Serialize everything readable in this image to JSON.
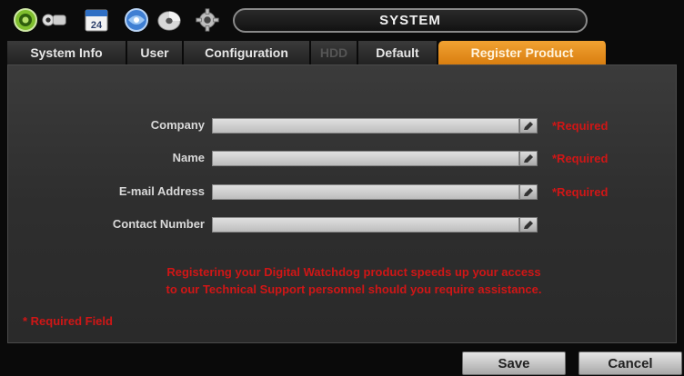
{
  "header": {
    "title": "SYSTEM",
    "calendar_day": "24",
    "icons": [
      "gear-icon",
      "camera-icon",
      "calendar-icon",
      "network-icon",
      "disc-icon",
      "gear-icon"
    ]
  },
  "tabs": [
    {
      "label": "System Info",
      "state": "normal"
    },
    {
      "label": "User",
      "state": "normal"
    },
    {
      "label": "Configuration",
      "state": "normal"
    },
    {
      "label": "HDD",
      "state": "disabled"
    },
    {
      "label": "Default",
      "state": "normal"
    },
    {
      "label": "Register Product",
      "state": "active"
    }
  ],
  "form": {
    "fields": [
      {
        "label": "Company",
        "value": "",
        "required_text": "*Required"
      },
      {
        "label": "Name",
        "value": "",
        "required_text": "*Required"
      },
      {
        "label": "E-mail Address",
        "value": "",
        "required_text": "*Required"
      },
      {
        "label": "Contact Number",
        "value": "",
        "required_text": ""
      }
    ],
    "notice_line1": "Registering your Digital Watchdog product speeds up your access",
    "notice_line2": "to our Technical Support personnel should you require assistance.",
    "required_note": "* Required Field"
  },
  "buttons": {
    "save": "Save",
    "cancel": "Cancel"
  },
  "colors": {
    "accent_orange": "#e58f1f",
    "required_red": "#d01616",
    "panel_gray": "#333333"
  }
}
